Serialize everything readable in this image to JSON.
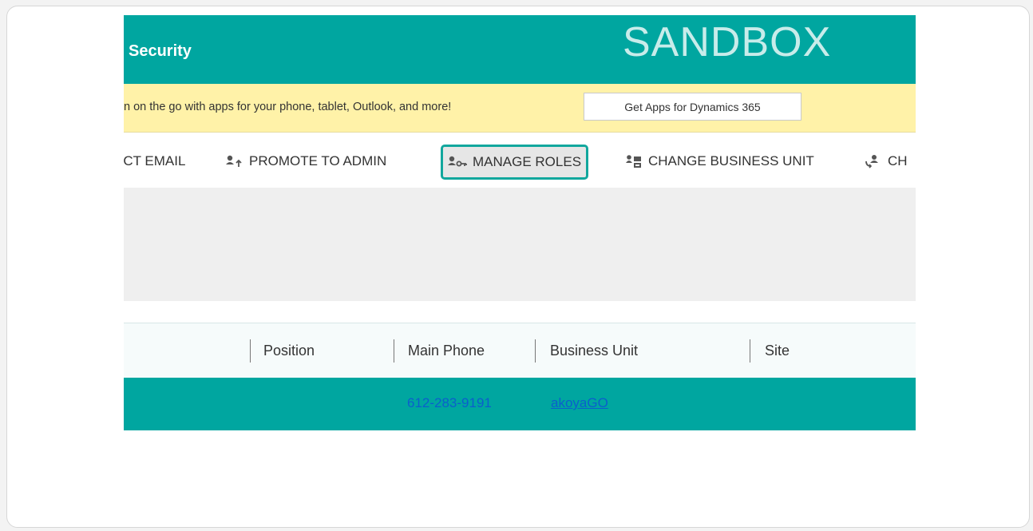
{
  "header": {
    "title": "Security",
    "environment": "SANDBOX",
    "color": "#00a6a0"
  },
  "banner": {
    "text": "n on the go with apps for your phone, tablet, Outlook, and more!",
    "button_label": "Get Apps for Dynamics 365"
  },
  "commands": {
    "email_label": "ECT EMAIL",
    "promote_label": "PROMOTE TO ADMIN",
    "manage_roles_label": "MANAGE ROLES",
    "change_bu_label": "CHANGE BUSINESS UNIT",
    "change_more_label": "CH",
    "highlight_color": "#12a79d"
  },
  "columns": {
    "position": "Position",
    "main_phone": "Main Phone",
    "business_unit": "Business Unit",
    "site": "Site"
  },
  "row": {
    "phone": "612-283-9191",
    "business_unit": "akoyaGO"
  }
}
